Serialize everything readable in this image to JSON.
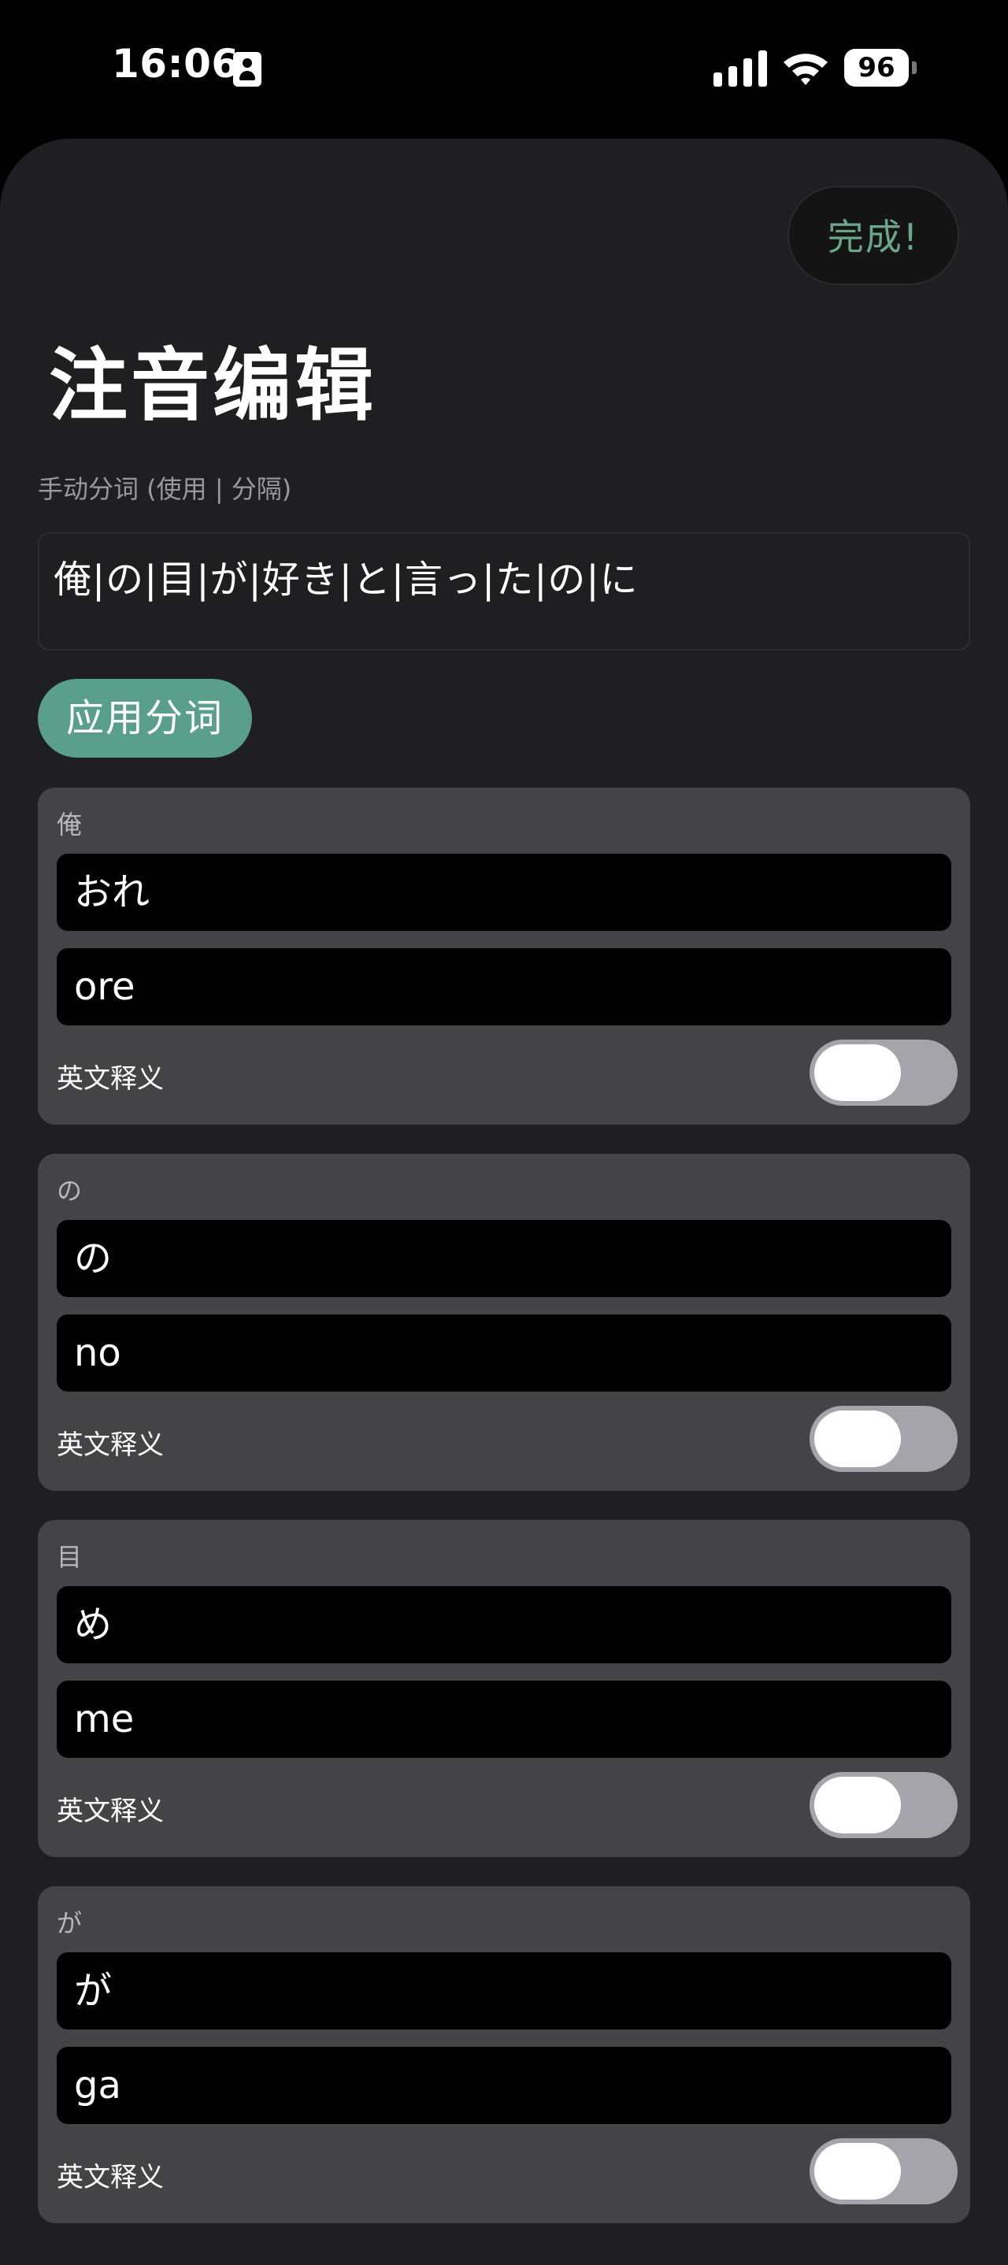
{
  "status_bar": {
    "time": "16:06",
    "battery": "96",
    "icons": [
      "id-card-icon",
      "signal-icon",
      "wifi-icon",
      "battery-icon"
    ]
  },
  "header": {
    "done_label": "完成!",
    "title": "注音编辑"
  },
  "segmentation": {
    "label": "手动分词 (使用 | 分隔)",
    "value": "俺|の|目|が|好き|と|言っ|た|の|に",
    "apply_label": "应用分词"
  },
  "words": [
    {
      "title": "俺",
      "kana": "おれ",
      "romaji": "ore",
      "toggle_label": "英文释义",
      "toggle_on": false
    },
    {
      "title": "の",
      "kana": "の",
      "romaji": "no",
      "toggle_label": "英文释义",
      "toggle_on": false
    },
    {
      "title": "目",
      "kana": "め",
      "romaji": "me",
      "toggle_label": "英文释义",
      "toggle_on": false
    },
    {
      "title": "が",
      "kana": "が",
      "romaji": "ga",
      "toggle_label": "英文释义",
      "toggle_on": false
    }
  ],
  "colors": {
    "accent": "#5a9f8a",
    "done_text": "#6aa58e",
    "sheet_bg": "#1f1f21",
    "card_bg": "#444446",
    "field_bg": "#000000",
    "toggle_off": "#a4a4aa"
  }
}
